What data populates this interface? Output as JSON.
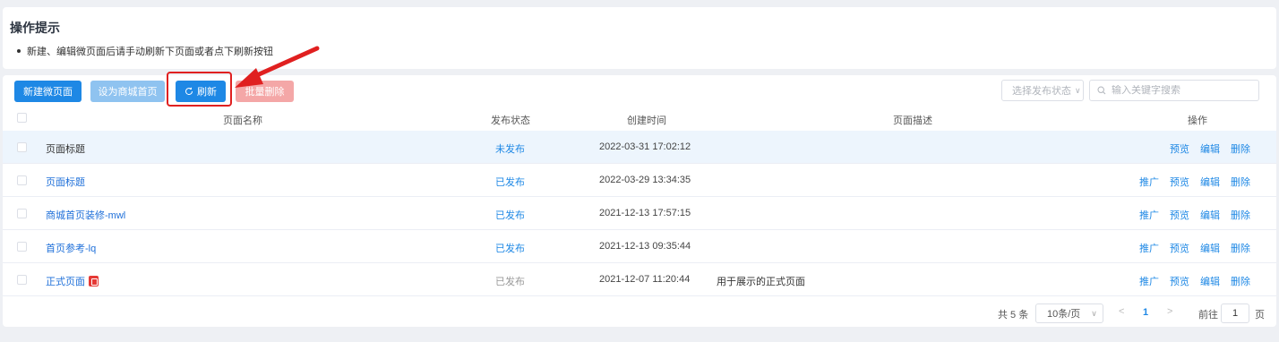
{
  "tips": {
    "title": "操作提示",
    "item": "新建、编辑微页面后请手动刷新下页面或者点下刷新按钮"
  },
  "toolbar": {
    "new_label": "新建微页面",
    "set_home_label": "设为商城首页",
    "refresh_label": "刷新",
    "batch_delete_label": "批量删除",
    "status_select": "选择发布状态",
    "search_placeholder": "输入关键字搜索"
  },
  "table": {
    "headers": [
      "页面名称",
      "发布状态",
      "创建时间",
      "页面描述",
      "操作"
    ],
    "rows": [
      {
        "name": "页面标题",
        "status": "未发布",
        "time": "2022-03-31 17:02:12",
        "desc": "",
        "actions": [
          "预览",
          "编辑",
          "删除"
        ]
      },
      {
        "name": "页面标题",
        "status": "已发布",
        "time": "2022-03-29 13:34:35",
        "desc": "",
        "actions": [
          "推广",
          "预览",
          "编辑",
          "删除"
        ]
      },
      {
        "name": "商城首页装修-mwl",
        "status": "已发布",
        "time": "2021-12-13 17:57:15",
        "desc": "",
        "actions": [
          "推广",
          "预览",
          "编辑",
          "删除"
        ]
      },
      {
        "name": "首页参考-lq",
        "status": "已发布",
        "time": "2021-12-13 09:35:44",
        "desc": "",
        "actions": [
          "推广",
          "预览",
          "编辑",
          "删除"
        ]
      },
      {
        "name": "正式页面",
        "status": "已发布",
        "time": "2021-12-07 11:20:44",
        "desc": "用于展示的正式页面",
        "actions": [
          "推广",
          "预览",
          "编辑",
          "删除"
        ]
      }
    ]
  },
  "pagination": {
    "total": "共 5 条",
    "page_size": "10条/页",
    "prev": "<",
    "current": "1",
    "next": ">",
    "goto_label": "前往",
    "goto_value": "1",
    "page_suffix": "页"
  },
  "colors": {
    "accent": "#1e88e5",
    "highlight": "#e02020"
  }
}
